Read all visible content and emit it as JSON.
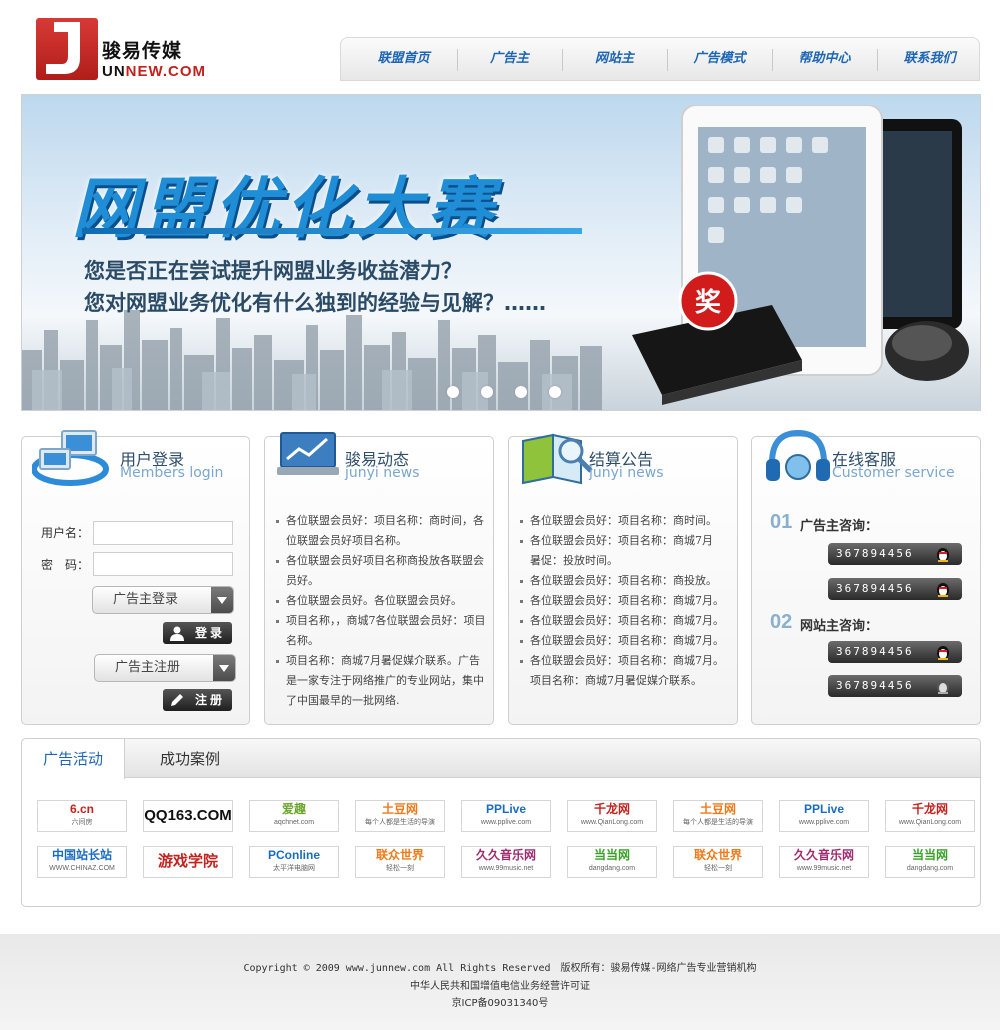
{
  "header": {
    "brand_name": "骏易传媒",
    "brand_domain": "NEW.COM",
    "logo_letters": "UN",
    "nav": [
      "联盟首页",
      "广告主",
      "网站主",
      "广告模式",
      "帮助中心",
      "联系我们"
    ]
  },
  "banner": {
    "headline": "网盟优化大赛",
    "line1": "您是否正在尝试提升网盟业务收益潜力？",
    "line2": "您对网盟业务优化有什么独到的经验与见解？……",
    "badge": "奖",
    "slides": 4
  },
  "login": {
    "title": "用户登录",
    "subtitle": "Members login",
    "username_label": "用户名：",
    "password_label": "密　码：",
    "username_value": "",
    "password_value": "",
    "login_type": "广告主登录",
    "login_button": "登录",
    "register_type": "广告主注册",
    "register_button": "注册"
  },
  "news": {
    "title": "骏易动态",
    "subtitle": "junyi news",
    "items": [
      "各位联盟会员好：项目名称：商时间，各位联盟会员好项目名称。",
      "各位联盟会员好项目名称商投放各联盟会员好。",
      "各位联盟会员好。各位联盟会员好。",
      "项目名称，，商城7各位联盟会员好：项目名称。",
      "项目名称：商城7月暑促媒介联系。广告是一家专注于网络推广的专业网站，集中了中国最早的一批网络."
    ]
  },
  "notice": {
    "title": "结算公告",
    "subtitle": "junyi news",
    "items": [
      "各位联盟会员好：项目名称：商时间。",
      "各位联盟会员好：项目名称：商城7月",
      "暑促：投放时间。",
      "各位联盟会员好：项目名称：商投放。",
      "各位联盟会员好：项目名称：商城7月。",
      "各位联盟会员好：项目名称：商城7月。",
      "各位联盟会员好：项目名称：商城7月。",
      "各位联盟会员好：项目名称：商城7月。",
      "项目名称：商城7月暑促媒介联系。"
    ]
  },
  "service": {
    "title": "在线客服",
    "subtitle": "Customer service",
    "groups": [
      {
        "num": "01",
        "label": "广告主咨询：",
        "numbers": [
          "367894456",
          "367894456"
        ]
      },
      {
        "num": "02",
        "label": "网站主咨询：",
        "numbers": [
          "367894456",
          "367894456"
        ]
      }
    ]
  },
  "partners": {
    "tabs": [
      "广告活动",
      "成功案例"
    ],
    "active_tab": 0,
    "logos": [
      {
        "text": "6.cn",
        "sub": "六间房",
        "color": "#c3221e"
      },
      {
        "text": "QQ163.COM",
        "sub": "",
        "color": "#111111"
      },
      {
        "text": "爱趣",
        "sub": "aqchnet.com",
        "color": "#6aa52a"
      },
      {
        "text": "土豆网",
        "sub": "每个人都是生活的导演",
        "color": "#f07a1a"
      },
      {
        "text": "PPLive",
        "sub": "www.pplive.com",
        "color": "#1a6cc2"
      },
      {
        "text": "千龙网",
        "sub": "www.QianLong.com",
        "color": "#c3221e"
      },
      {
        "text": "土豆网",
        "sub": "每个人都是生活的导演",
        "color": "#f07a1a"
      },
      {
        "text": "PPLive",
        "sub": "www.pplive.com",
        "color": "#1a6cc2"
      },
      {
        "text": "千龙网",
        "sub": "www.QianLong.com",
        "color": "#c3221e"
      },
      {
        "text": "中国站长站",
        "sub": "WWW.CHINAZ.COM",
        "color": "#1a6cc2"
      },
      {
        "text": "游戏学院",
        "sub": "",
        "color": "#c3221e"
      },
      {
        "text": "PConline",
        "sub": "太平洋电脑网",
        "color": "#1a6cc2"
      },
      {
        "text": "联众世界",
        "sub": "轻松一刻",
        "color": "#f07a1a"
      },
      {
        "text": "久久音乐网",
        "sub": "www.99music.net",
        "color": "#a02c6e"
      },
      {
        "text": "当当网",
        "sub": "dangdang.com",
        "color": "#3aa02a"
      },
      {
        "text": "联众世界",
        "sub": "轻松一刻",
        "color": "#f07a1a"
      },
      {
        "text": "久久音乐网",
        "sub": "www.99music.net",
        "color": "#a02c6e"
      },
      {
        "text": "当当网",
        "sub": "dangdang.com",
        "color": "#3aa02a"
      }
    ]
  },
  "footer": {
    "line1": "Copyright © 2009 www.junnew.com All Rights Reserved　版权所有：骏易传媒-网络广告专业营销机构",
    "line2": "中华人民共和国增值电信业务经营许可证",
    "line3": "京ICP备09031340号"
  }
}
